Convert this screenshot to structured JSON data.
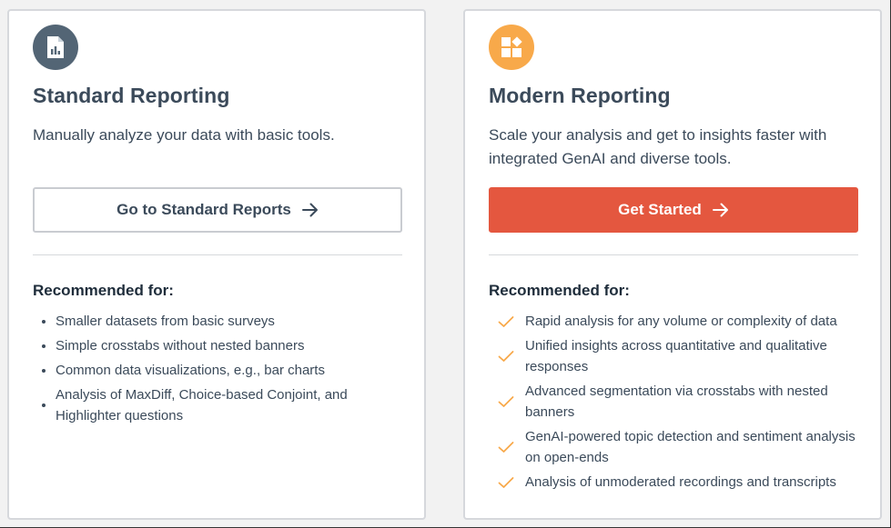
{
  "standard": {
    "icon": "report-document-icon",
    "title": "Standard Reporting",
    "description": "Manually analyze your data with basic tools.",
    "button_label": "Go to Standard Reports",
    "recommended_heading": "Recommended for:",
    "items": [
      {
        "label": "Smaller datasets from basic surveys"
      },
      {
        "label": "Simple crosstabs without nested banners"
      },
      {
        "label": "Common data visualizations, e.g., bar charts"
      },
      {
        "label": "Analysis of MaxDiff, Choice-based Conjoint, and Highlighter questions"
      }
    ]
  },
  "modern": {
    "icon": "widgets-icon",
    "title": "Modern Reporting",
    "description": "Scale your analysis and get to insights faster with integrated GenAI and diverse tools.",
    "button_label": "Get Started",
    "recommended_heading": "Recommended for:",
    "items": [
      {
        "label": "Rapid analysis for any volume or complexity of data"
      },
      {
        "label": "Unified insights across quantitative and qualitative responses"
      },
      {
        "label": "Advanced segmentation via crosstabs with nested banners"
      },
      {
        "label": "GenAI-powered topic detection and sentiment analysis on open-ends"
      },
      {
        "label": "Analysis of unmoderated recordings and transcripts"
      }
    ]
  },
  "colors": {
    "primary_button": "#e4573f",
    "standard_badge": "#536575",
    "modern_badge": "#f8a94a",
    "check": "#f8a94a",
    "text": "#3b4a5a"
  }
}
